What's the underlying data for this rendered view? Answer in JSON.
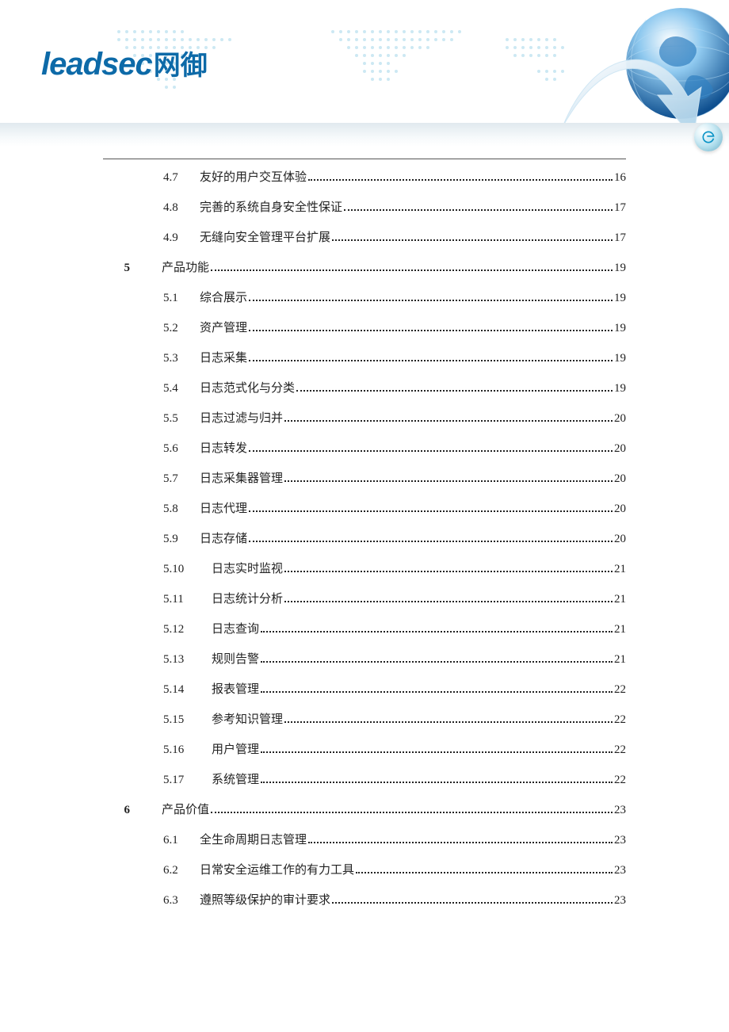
{
  "logo": {
    "en": "leadsec",
    "cn": "网御"
  },
  "toc": [
    {
      "type": "sub",
      "num": "4.7",
      "title": "友好的用户交互体验",
      "page": "16",
      "indent": false
    },
    {
      "type": "sub",
      "num": "4.8",
      "title": "完善的系统自身安全性保证",
      "page": "17",
      "indent": false
    },
    {
      "type": "sub",
      "num": "4.9",
      "title": "无缝向安全管理平台扩展",
      "page": "17",
      "indent": false
    },
    {
      "type": "section",
      "num": "5",
      "title": "产品功能",
      "page": "19"
    },
    {
      "type": "sub",
      "num": "5.1",
      "title": "综合展示",
      "page": "19",
      "indent": false
    },
    {
      "type": "sub",
      "num": "5.2",
      "title": "资产管理",
      "page": "19",
      "indent": false
    },
    {
      "type": "sub",
      "num": "5.3",
      "title": "日志采集",
      "page": "19",
      "indent": false
    },
    {
      "type": "sub",
      "num": "5.4",
      "title": "日志范式化与分类",
      "page": "19",
      "indent": false
    },
    {
      "type": "sub",
      "num": "5.5",
      "title": "日志过滤与归并",
      "page": "20",
      "indent": false
    },
    {
      "type": "sub",
      "num": "5.6",
      "title": "日志转发",
      "page": "20",
      "indent": false
    },
    {
      "type": "sub",
      "num": "5.7",
      "title": "日志采集器管理",
      "page": "20",
      "indent": false
    },
    {
      "type": "sub",
      "num": "5.8",
      "title": "日志代理",
      "page": "20",
      "indent": false
    },
    {
      "type": "sub",
      "num": "5.9",
      "title": "日志存储",
      "page": "20",
      "indent": false
    },
    {
      "type": "sub",
      "num": "5.10",
      "title": "日志实时监视",
      "page": "21",
      "indent": true
    },
    {
      "type": "sub",
      "num": "5.11",
      "title": "日志统计分析",
      "page": "21",
      "indent": true
    },
    {
      "type": "sub",
      "num": "5.12",
      "title": "日志查询",
      "page": "21",
      "indent": true
    },
    {
      "type": "sub",
      "num": "5.13",
      "title": "规则告警",
      "page": "21",
      "indent": true
    },
    {
      "type": "sub",
      "num": "5.14",
      "title": "报表管理",
      "page": "22",
      "indent": true
    },
    {
      "type": "sub",
      "num": "5.15",
      "title": "参考知识管理",
      "page": "22",
      "indent": true
    },
    {
      "type": "sub",
      "num": "5.16",
      "title": "用户管理",
      "page": "22",
      "indent": true
    },
    {
      "type": "sub",
      "num": "5.17",
      "title": "系统管理",
      "page": "22",
      "indent": true
    },
    {
      "type": "section",
      "num": "6",
      "title": "产品价值",
      "page": "23"
    },
    {
      "type": "sub",
      "num": "6.1",
      "title": "全生命周期日志管理",
      "page": "23",
      "indent": false
    },
    {
      "type": "sub",
      "num": "6.2",
      "title": "日常安全运维工作的有力工具",
      "page": "23",
      "indent": false
    },
    {
      "type": "sub",
      "num": "6.3",
      "title": "遵照等级保护的审计要求",
      "page": "23",
      "indent": false
    }
  ]
}
